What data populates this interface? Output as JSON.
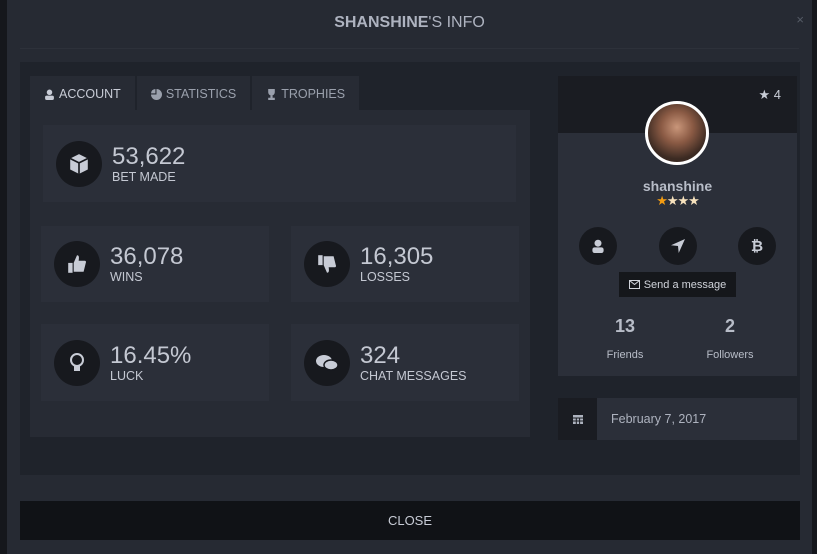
{
  "modal": {
    "title_bold": "SHANSHINE",
    "title_rest": "'S INFO",
    "close_x": "×",
    "close_label": "CLOSE"
  },
  "tabs": [
    {
      "label": "ACCOUNT",
      "icon": "user-icon"
    },
    {
      "label": "STATISTICS",
      "icon": "pie-chart-icon"
    },
    {
      "label": "TROPHIES",
      "icon": "trophy-icon"
    }
  ],
  "stats": {
    "bets": {
      "value": "53,622",
      "label": "BET MADE",
      "icon": "cube-icon"
    },
    "wins": {
      "value": "36,078",
      "label": "WINS",
      "icon": "thumbs-up-icon"
    },
    "losses": {
      "value": "16,305",
      "label": "LOSSES",
      "icon": "thumbs-down-icon"
    },
    "luck": {
      "value": "16.45%",
      "label": "LUCK",
      "icon": "lightbulb-icon"
    },
    "chat": {
      "value": "324",
      "label": "CHAT MESSAGES",
      "icon": "comments-icon"
    }
  },
  "profile": {
    "rating": "4",
    "username": "shanshine",
    "stars_filled": 1,
    "stars_total": 4,
    "send_message": "Send a message",
    "friends_count": "13",
    "friends_label": "Friends",
    "followers_count": "2",
    "followers_label": "Followers",
    "joined": "February 7, 2017"
  },
  "colors": {
    "star_filled": "#f39c12",
    "star_empty": "#f7e2bd",
    "background": "#262a33"
  }
}
